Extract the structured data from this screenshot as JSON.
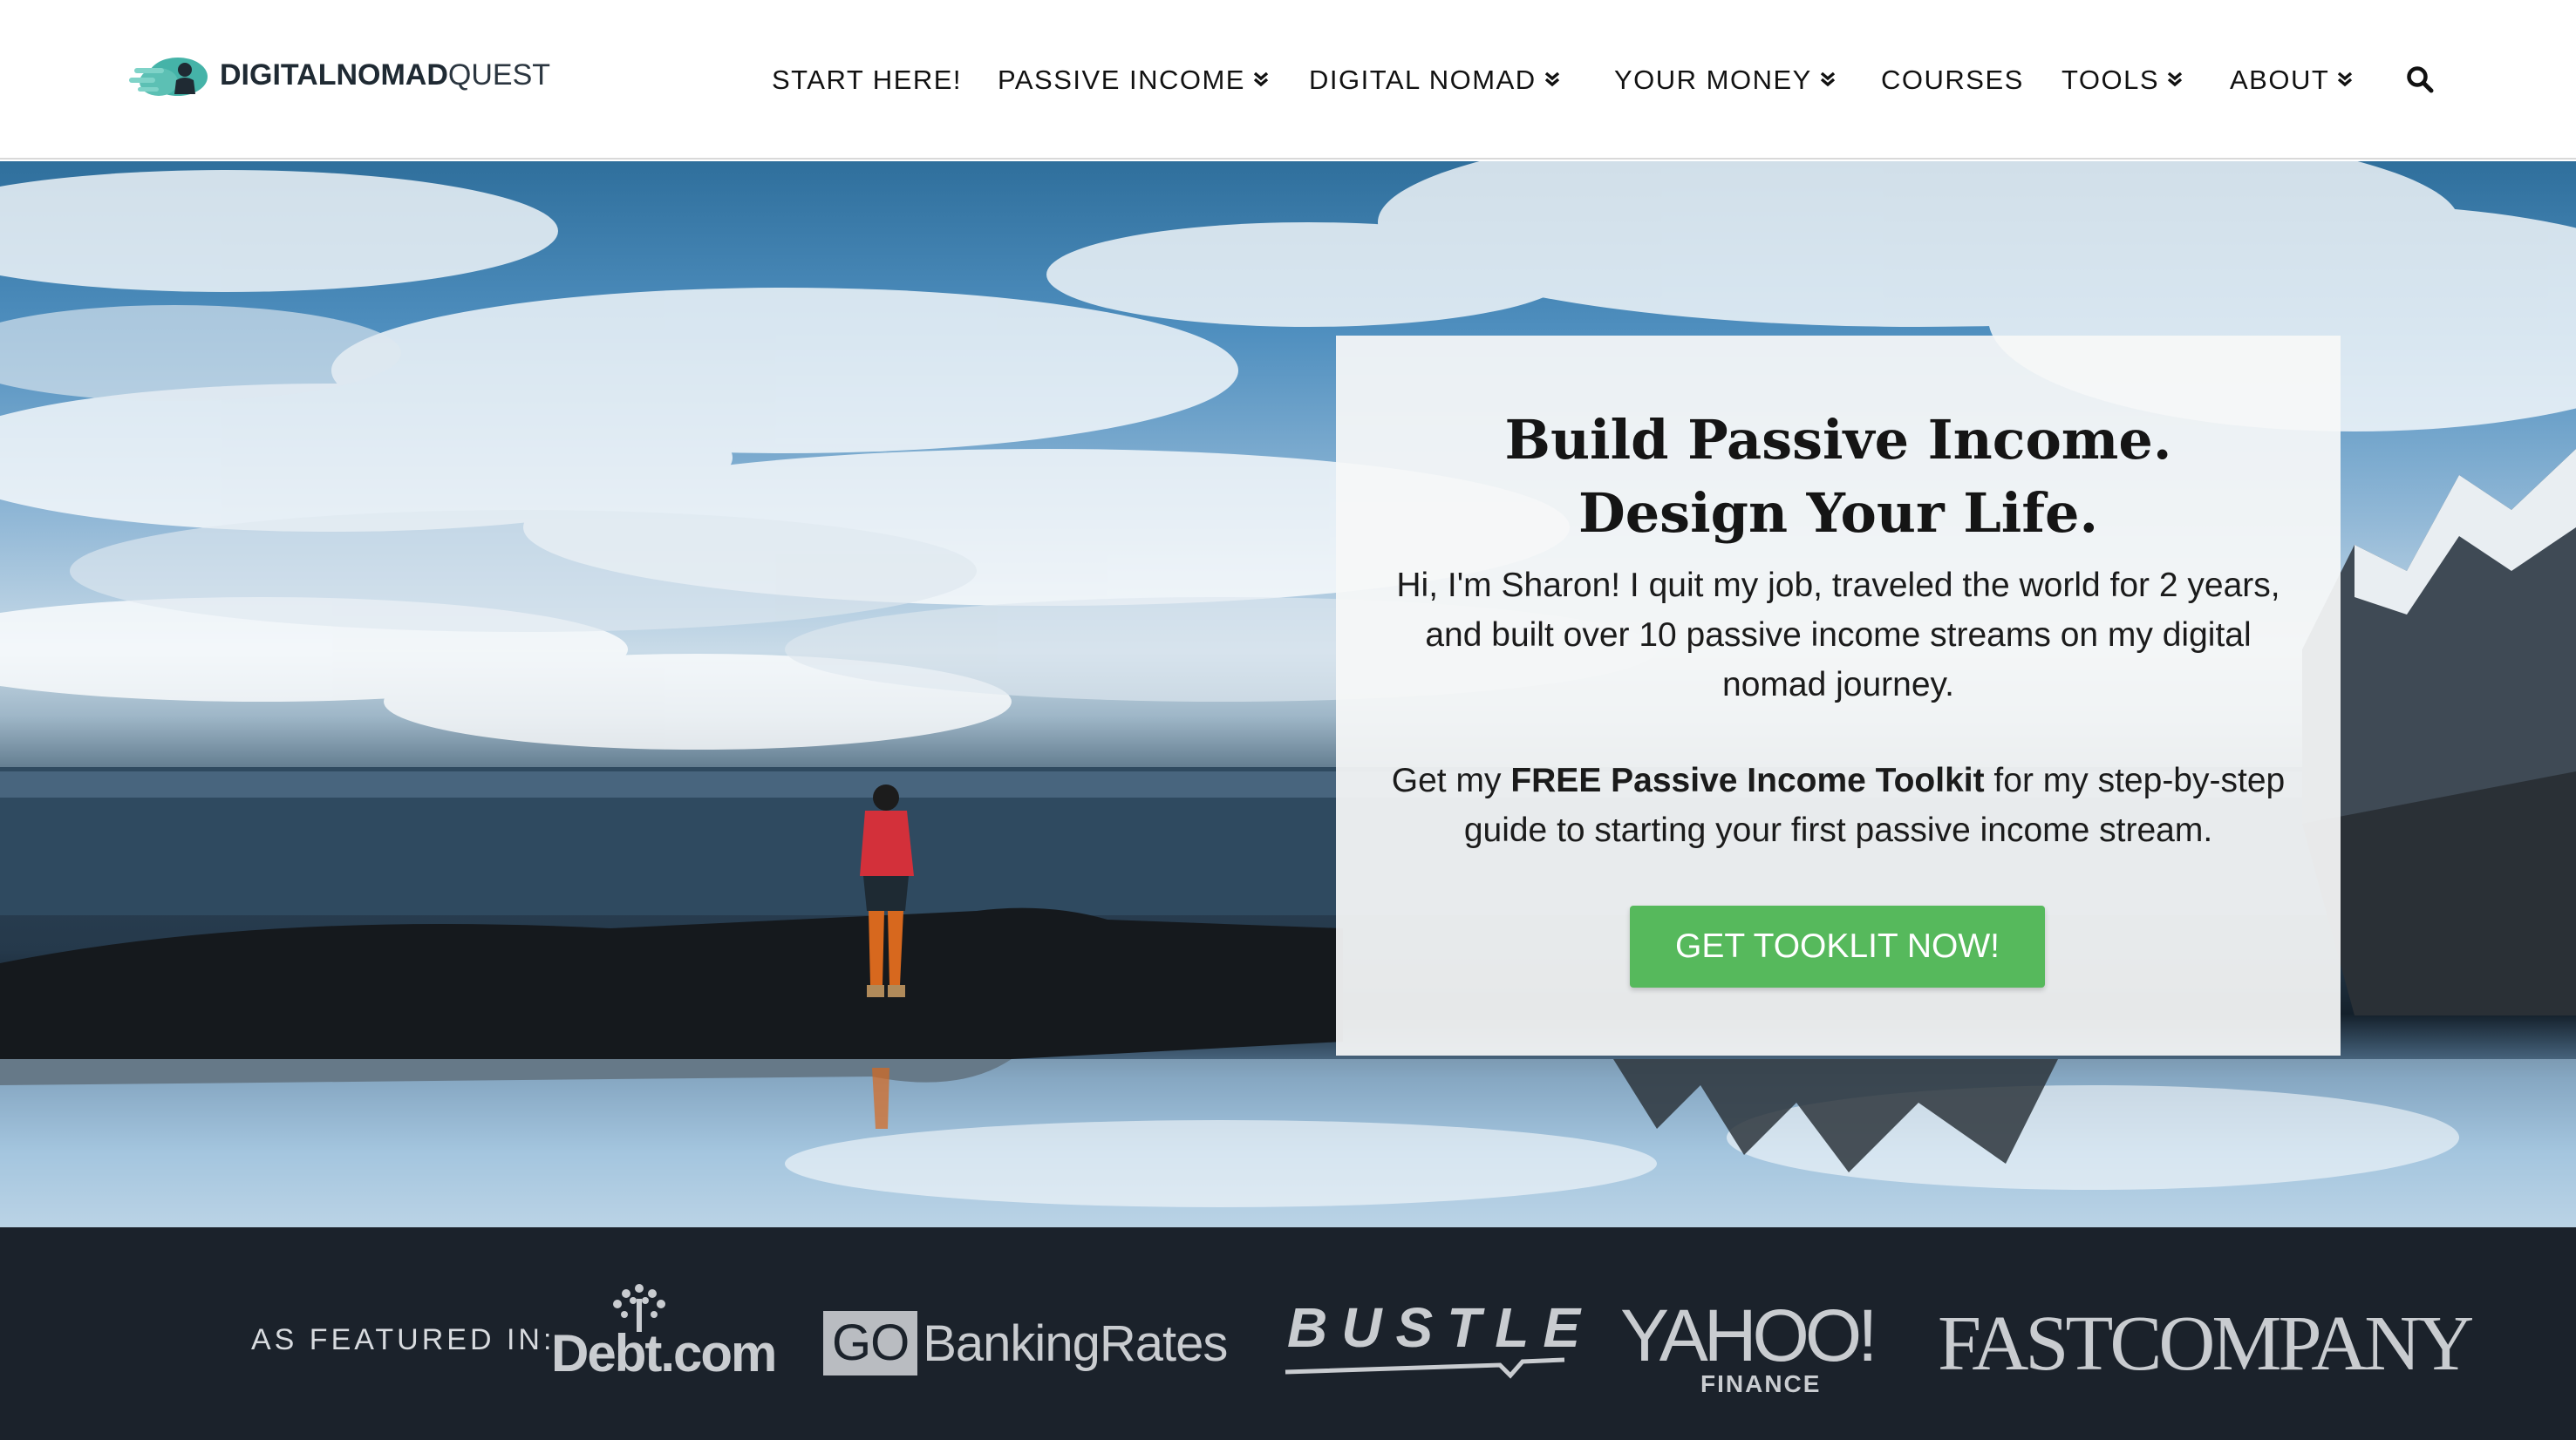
{
  "header": {
    "logo": {
      "bold": "DIGITALNOMAD",
      "light": "QUEST"
    },
    "nav": [
      {
        "label": "START HERE!",
        "has_dropdown": false
      },
      {
        "label": "PASSIVE INCOME",
        "has_dropdown": true
      },
      {
        "label": "DIGITAL NOMAD",
        "has_dropdown": true
      },
      {
        "label": "YOUR MONEY",
        "has_dropdown": true
      },
      {
        "label": "COURSES",
        "has_dropdown": false
      },
      {
        "label": "TOOLS",
        "has_dropdown": true
      },
      {
        "label": "ABOUT",
        "has_dropdown": true
      }
    ],
    "search_icon": "search-icon"
  },
  "hero": {
    "title_line1": "Build Passive Income.",
    "title_line2": "Design Your Life.",
    "intro": "Hi, I'm Sharon! I quit my job, traveled the world for 2 years, and built over 10 passive income streams on my digital nomad journey.",
    "offer_prefix": "Get my ",
    "offer_bold": "FREE Passive Income Toolkit",
    "offer_suffix": " for my step-by-step guide to starting your first passive income stream.",
    "cta_label": "GET TOOKLIT NOW!"
  },
  "featured": {
    "label": "AS FEATURED IN:",
    "outlets": {
      "debt": "Debt.com",
      "gobr_go": "GO",
      "gobr_rest": "BankingRates",
      "bustle": "BUSTLE",
      "yahoo": "YAHOO!",
      "yahoo_sub": "FINANCE",
      "fastco": "FASTCOMPANY"
    }
  },
  "colors": {
    "accent_green": "#56b95c",
    "featured_bg": "#1b222b",
    "logo_teal": "#3aa7a0"
  }
}
